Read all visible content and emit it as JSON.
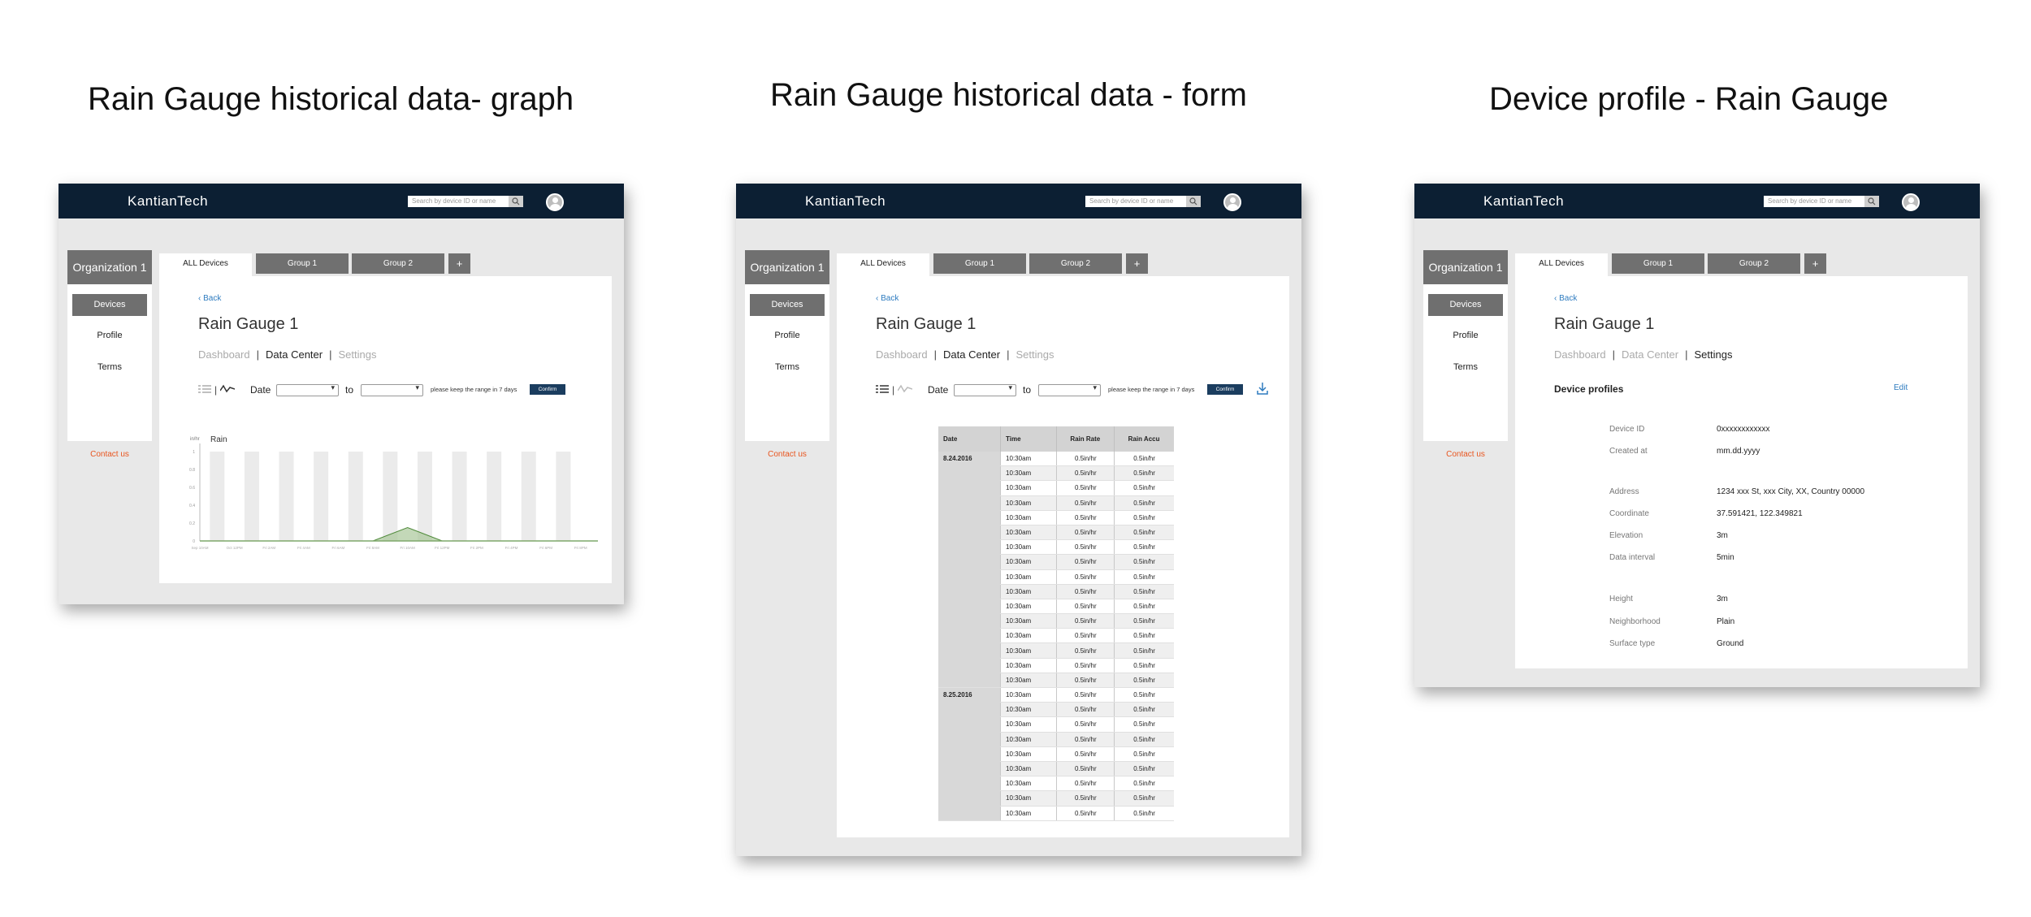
{
  "captions": {
    "graph": "Rain Gauge historical data- graph",
    "form": "Rain Gauge historical data - form",
    "profile": "Device profile - Rain Gauge"
  },
  "app": {
    "brand": "KantianTech",
    "search_placeholder": "Search by device ID or name",
    "org_button": "Organization 1",
    "sidebar": [
      "Devices",
      "Profile",
      "Terms"
    ],
    "contact": "Contact us",
    "tabs": [
      "ALL Devices",
      "Group 1",
      "Group 2",
      "+"
    ],
    "back": "Back",
    "device_title": "Rain Gauge 1",
    "subnav": [
      "Dashboard",
      "Data Center",
      "Settings"
    ],
    "accent_color": "#2d7bbf",
    "topbar_color": "#0c1f33",
    "contact_color": "#e8551f"
  },
  "filter": {
    "date_label": "Date",
    "to_label": "to",
    "hint": "please keep the range in 7 days",
    "confirm": "Confirm"
  },
  "graph": {
    "chart_data": {
      "type": "area",
      "title": "Rain",
      "ylabel": "in/hr",
      "y_ticks": [
        "1",
        "0.8",
        "0.6",
        "0.4",
        "0.2",
        "0"
      ],
      "x": [
        "Sep 10AM",
        "Oct 12PM",
        "Fri 2AM",
        "Fri 4AM",
        "Fri 6AM",
        "Fri 8AM",
        "Fri 10AM",
        "Fri 12PM",
        "Fri 2PM",
        "Fri 4PM",
        "Fri 6PM",
        "Fri 8PM"
      ],
      "values": [
        0,
        0,
        0,
        0,
        0,
        0,
        0.15,
        0,
        0,
        0,
        0,
        0
      ],
      "bars": [
        1,
        1,
        1,
        1,
        1,
        1,
        1,
        1,
        1,
        1,
        1
      ],
      "ylim": [
        0,
        1
      ]
    }
  },
  "form_table": {
    "headers": [
      "Date",
      "Time",
      "Rain Rate",
      "Rain Accu"
    ],
    "groups": [
      {
        "date": "8.24.2016",
        "rows": 16
      },
      {
        "date": "8.25.2016",
        "rows": 9
      }
    ],
    "time": "10:30am",
    "rate": "0.5in/hr",
    "accu": "0.5in/hr"
  },
  "profile": {
    "heading": "Device profiles",
    "edit": "Edit",
    "fields": [
      {
        "label": "Device ID",
        "value": "0xxxxxxxxxxxx"
      },
      {
        "label": "Created at",
        "value": "mm.dd.yyyy"
      },
      {
        "label": "Address",
        "value": "1234 xxx St, xxx City, XX, Country 00000"
      },
      {
        "label": "Coordinate",
        "value": "37.591421, 122.349821"
      },
      {
        "label": "Elevation",
        "value": "3m"
      },
      {
        "label": "Data interval",
        "value": "5min"
      },
      {
        "label": "Height",
        "value": "3m"
      },
      {
        "label": "Neighborhood",
        "value": "Plain"
      },
      {
        "label": "Surface type",
        "value": "Ground"
      }
    ]
  }
}
